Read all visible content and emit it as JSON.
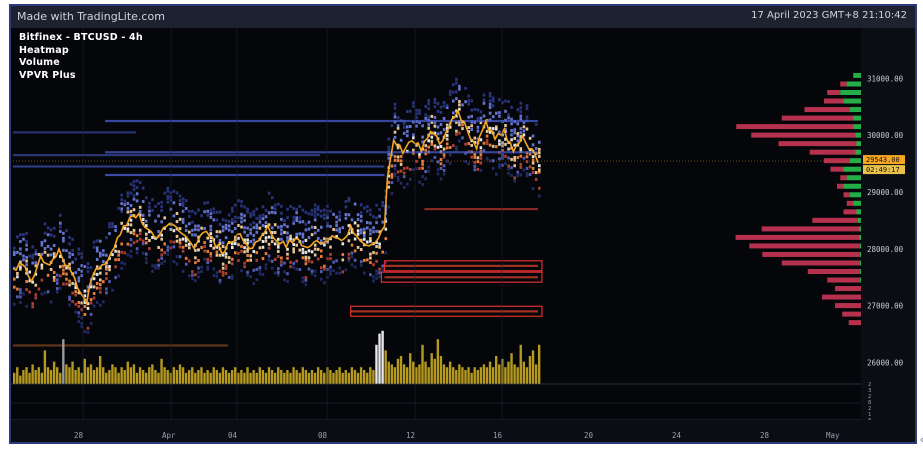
{
  "header": {
    "brand": "Made with TradingLite.com",
    "timestamp": "17 April 2023 GMT+8 21:10:42"
  },
  "legend": [
    "Bitfinex - BTCUSD - 4h",
    "Heatmap",
    "Volume",
    "VPVR Plus"
  ],
  "colors": {
    "background": "#05060a",
    "frame": "#2f3a78",
    "price_line": "#f5a623",
    "volume_bar": "#b59a1e",
    "vpvr_buy": "#27c24c",
    "vpvr_sell": "#d63a5a",
    "heat_cold": "#3b4ea8",
    "heat_hot": "#ffffff",
    "price_label": "#f5a623"
  },
  "chart_data": {
    "type": "heatmap",
    "symbol": "BTCUSD",
    "exchange": "Bitfinex",
    "timeframe": "4h",
    "x_tick_labels": [
      "28",
      "Apr",
      "04",
      "08",
      "12",
      "16",
      "20",
      "24",
      "28",
      "May"
    ],
    "y_tick_labels": [
      "31000.00",
      "30000.00",
      "29000.00",
      "28000.00",
      "27000.00",
      "26000.00"
    ],
    "y_ticks": [
      31000,
      30000,
      29000,
      28000,
      27000,
      26000
    ],
    "ylim": [
      25620,
      31850
    ],
    "current_price": "29543.00",
    "current_price_value": 29543,
    "countdown": "02:49:17",
    "volume_tick_labels": [
      "2",
      "3",
      "2",
      "8",
      "2",
      "1",
      "0"
    ],
    "price_series": [
      {
        "x": 0,
        "y": 27600
      },
      {
        "x": 3,
        "y": 27750
      },
      {
        "x": 6,
        "y": 27400
      },
      {
        "x": 9,
        "y": 27850
      },
      {
        "x": 12,
        "y": 27700
      },
      {
        "x": 15,
        "y": 27950
      },
      {
        "x": 18,
        "y": 27650
      },
      {
        "x": 21,
        "y": 27350
      },
      {
        "x": 24,
        "y": 27100
      },
      {
        "x": 26,
        "y": 27550
      },
      {
        "x": 29,
        "y": 27700
      },
      {
        "x": 32,
        "y": 27900
      },
      {
        "x": 35,
        "y": 28300
      },
      {
        "x": 38,
        "y": 28500
      },
      {
        "x": 41,
        "y": 28600
      },
      {
        "x": 44,
        "y": 28300
      },
      {
        "x": 47,
        "y": 28150
      },
      {
        "x": 50,
        "y": 28450
      },
      {
        "x": 53,
        "y": 28350
      },
      {
        "x": 56,
        "y": 28200
      },
      {
        "x": 59,
        "y": 28050
      },
      {
        "x": 62,
        "y": 28300
      },
      {
        "x": 65,
        "y": 28150
      },
      {
        "x": 68,
        "y": 27950
      },
      {
        "x": 71,
        "y": 28100
      },
      {
        "x": 74,
        "y": 28250
      },
      {
        "x": 77,
        "y": 28000
      },
      {
        "x": 80,
        "y": 28100
      },
      {
        "x": 83,
        "y": 28350
      },
      {
        "x": 86,
        "y": 28150
      },
      {
        "x": 89,
        "y": 28050
      },
      {
        "x": 92,
        "y": 28200
      },
      {
        "x": 95,
        "y": 28000
      },
      {
        "x": 98,
        "y": 28150
      },
      {
        "x": 101,
        "y": 28050
      },
      {
        "x": 104,
        "y": 28250
      },
      {
        "x": 107,
        "y": 28100
      },
      {
        "x": 110,
        "y": 28350
      },
      {
        "x": 113,
        "y": 28200
      },
      {
        "x": 116,
        "y": 28050
      },
      {
        "x": 119,
        "y": 28150
      },
      {
        "x": 121,
        "y": 28400
      },
      {
        "x": 122,
        "y": 29300
      },
      {
        "x": 124,
        "y": 29900
      },
      {
        "x": 127,
        "y": 29700
      },
      {
        "x": 130,
        "y": 29950
      },
      {
        "x": 133,
        "y": 29750
      },
      {
        "x": 136,
        "y": 30100
      },
      {
        "x": 139,
        "y": 29850
      },
      {
        "x": 142,
        "y": 30150
      },
      {
        "x": 145,
        "y": 30450
      },
      {
        "x": 148,
        "y": 30050
      },
      {
        "x": 151,
        "y": 29800
      },
      {
        "x": 154,
        "y": 30200
      },
      {
        "x": 157,
        "y": 29950
      },
      {
        "x": 160,
        "y": 30050
      },
      {
        "x": 163,
        "y": 29750
      },
      {
        "x": 166,
        "y": 30000
      },
      {
        "x": 169,
        "y": 29700
      },
      {
        "x": 171,
        "y": 29543
      }
    ],
    "volume": [
      0.2,
      0.3,
      0.15,
      0.25,
      0.3,
      0.2,
      0.35,
      0.25,
      0.3,
      0.2,
      0.6,
      0.3,
      0.25,
      0.4,
      0.3,
      0.2,
      0.8,
      0.35,
      0.3,
      0.4,
      0.25,
      0.3,
      0.2,
      0.45,
      0.3,
      0.35,
      0.25,
      0.3,
      0.5,
      0.3,
      0.2,
      0.25,
      0.35,
      0.3,
      0.2,
      0.3,
      0.25,
      0.4,
      0.3,
      0.35,
      0.2,
      0.3,
      0.25,
      0.2,
      0.3,
      0.35,
      0.25,
      0.2,
      0.45,
      0.3,
      0.25,
      0.2,
      0.3,
      0.25,
      0.35,
      0.3,
      0.2,
      0.25,
      0.3,
      0.2,
      0.25,
      0.3,
      0.2,
      0.25,
      0.2,
      0.3,
      0.25,
      0.2,
      0.3,
      0.25,
      0.2,
      0.25,
      0.3,
      0.2,
      0.25,
      0.2,
      0.3,
      0.2,
      0.25,
      0.2,
      0.3,
      0.25,
      0.2,
      0.3,
      0.25,
      0.2,
      0.3,
      0.25,
      0.2,
      0.25,
      0.2,
      0.3,
      0.25,
      0.2,
      0.3,
      0.25,
      0.2,
      0.25,
      0.2,
      0.3,
      0.25,
      0.2,
      0.3,
      0.25,
      0.2,
      0.25,
      0.3,
      0.2,
      0.25,
      0.2,
      0.3,
      0.25,
      0.2,
      0.3,
      0.25,
      0.2,
      0.3,
      0.25,
      0.7,
      0.9,
      0.95,
      0.6,
      0.4,
      0.35,
      0.3,
      0.45,
      0.5,
      0.35,
      0.3,
      0.55,
      0.4,
      0.3,
      0.35,
      0.7,
      0.4,
      0.3,
      0.55,
      0.45,
      0.8,
      0.5,
      0.35,
      0.3,
      0.4,
      0.3,
      0.25,
      0.35,
      0.3,
      0.25,
      0.3,
      0.2,
      0.3,
      0.25,
      0.3,
      0.35,
      0.3,
      0.4,
      0.3,
      0.5,
      0.35,
      0.45,
      0.3,
      0.4,
      0.55,
      0.35,
      0.3,
      0.7,
      0.4,
      0.3,
      0.5,
      0.6,
      0.35,
      0.7
    ],
    "vpvr_profile": [
      {
        "price": 31050,
        "buy": 0.15,
        "sell": 0.0
      },
      {
        "price": 30900,
        "buy": 0.25,
        "sell": 0.05
      },
      {
        "price": 30750,
        "buy": 0.35,
        "sell": 0.1
      },
      {
        "price": 30600,
        "buy": 0.3,
        "sell": 0.15
      },
      {
        "price": 30450,
        "buy": 0.2,
        "sell": 0.35
      },
      {
        "price": 30300,
        "buy": 0.15,
        "sell": 0.55
      },
      {
        "price": 30150,
        "buy": 0.15,
        "sell": 0.9
      },
      {
        "price": 30000,
        "buy": 0.12,
        "sell": 0.8
      },
      {
        "price": 29850,
        "buy": 0.1,
        "sell": 0.6
      },
      {
        "price": 29700,
        "buy": 0.12,
        "sell": 0.35
      },
      {
        "price": 29550,
        "buy": 0.2,
        "sell": 0.2
      },
      {
        "price": 29400,
        "buy": 0.3,
        "sell": 0.1
      },
      {
        "price": 29250,
        "buy": 0.25,
        "sell": 0.05
      },
      {
        "price": 29100,
        "buy": 0.3,
        "sell": 0.05
      },
      {
        "price": 28950,
        "buy": 0.2,
        "sell": 0.05
      },
      {
        "price": 28800,
        "buy": 0.15,
        "sell": 0.05
      },
      {
        "price": 28650,
        "buy": 0.1,
        "sell": 0.1
      },
      {
        "price": 28500,
        "buy": 0.08,
        "sell": 0.35
      },
      {
        "price": 28350,
        "buy": 0.06,
        "sell": 0.75
      },
      {
        "price": 28200,
        "buy": 0.06,
        "sell": 0.95
      },
      {
        "price": 28050,
        "buy": 0.05,
        "sell": 0.85
      },
      {
        "price": 27900,
        "buy": 0.05,
        "sell": 0.75
      },
      {
        "price": 27750,
        "buy": 0.05,
        "sell": 0.6
      },
      {
        "price": 27600,
        "buy": 0.05,
        "sell": 0.4
      },
      {
        "price": 27450,
        "buy": 0.05,
        "sell": 0.25
      },
      {
        "price": 27300,
        "buy": 0.03,
        "sell": 0.2
      },
      {
        "price": 27150,
        "buy": 0.03,
        "sell": 0.3
      },
      {
        "price": 27000,
        "buy": 0.03,
        "sell": 0.2
      },
      {
        "price": 26850,
        "buy": 0.02,
        "sell": 0.15
      },
      {
        "price": 26700,
        "buy": 0.02,
        "sell": 0.1
      }
    ],
    "resting_orders": [
      {
        "price": 30250,
        "x_start": 30,
        "x_end": 171,
        "strength": 0.7
      },
      {
        "price": 29700,
        "x_start": 30,
        "x_end": 171,
        "strength": 0.6
      },
      {
        "price": 29300,
        "x_start": 30,
        "x_end": 121,
        "strength": 0.8
      },
      {
        "price": 29450,
        "x_start": 0,
        "x_end": 121,
        "strength": 0.4
      },
      {
        "price": 29650,
        "x_start": 0,
        "x_end": 100,
        "strength": 0.3
      },
      {
        "price": 30050,
        "x_start": 0,
        "x_end": 40,
        "strength": 0.25
      },
      {
        "price": 27700,
        "x_start": 121,
        "x_end": 171,
        "strength": 0.9
      },
      {
        "price": 27500,
        "x_start": 121,
        "x_end": 171,
        "strength": 0.85
      },
      {
        "price": 26900,
        "x_start": 110,
        "x_end": 171,
        "strength": 0.9
      },
      {
        "price": 28700,
        "x_start": 134,
        "x_end": 171,
        "strength": 0.6
      },
      {
        "price": 26300,
        "x_start": 0,
        "x_end": 70,
        "strength": 0.6
      }
    ],
    "grid": false,
    "legend_position": "top-left",
    "price_axis_position": "right"
  }
}
